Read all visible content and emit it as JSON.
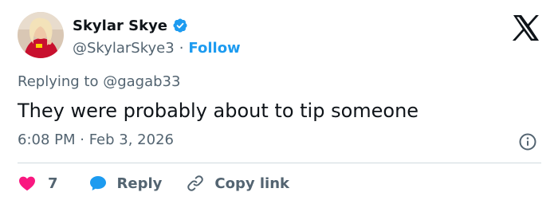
{
  "author": {
    "display_name": "Skylar Skye",
    "handle": "@SkylarSkye3",
    "separator": "·",
    "follow_label": "Follow",
    "avatar_icon": "user-avatar",
    "verified_icon": "verified-badge-icon"
  },
  "tweet": {
    "replying_to": "Replying to @gagab33",
    "text": "They were probably about to tip someone",
    "timestamp": "6:08 PM · Feb 3, 2026"
  },
  "actions": {
    "like_count": "7",
    "reply_label": "Reply",
    "copy_link_label": "Copy link"
  },
  "colors": {
    "accent": "#1d9bf0",
    "like": "#f91880",
    "text_primary": "#0f1419",
    "text_secondary": "#536471",
    "divider": "#cfd9de"
  }
}
